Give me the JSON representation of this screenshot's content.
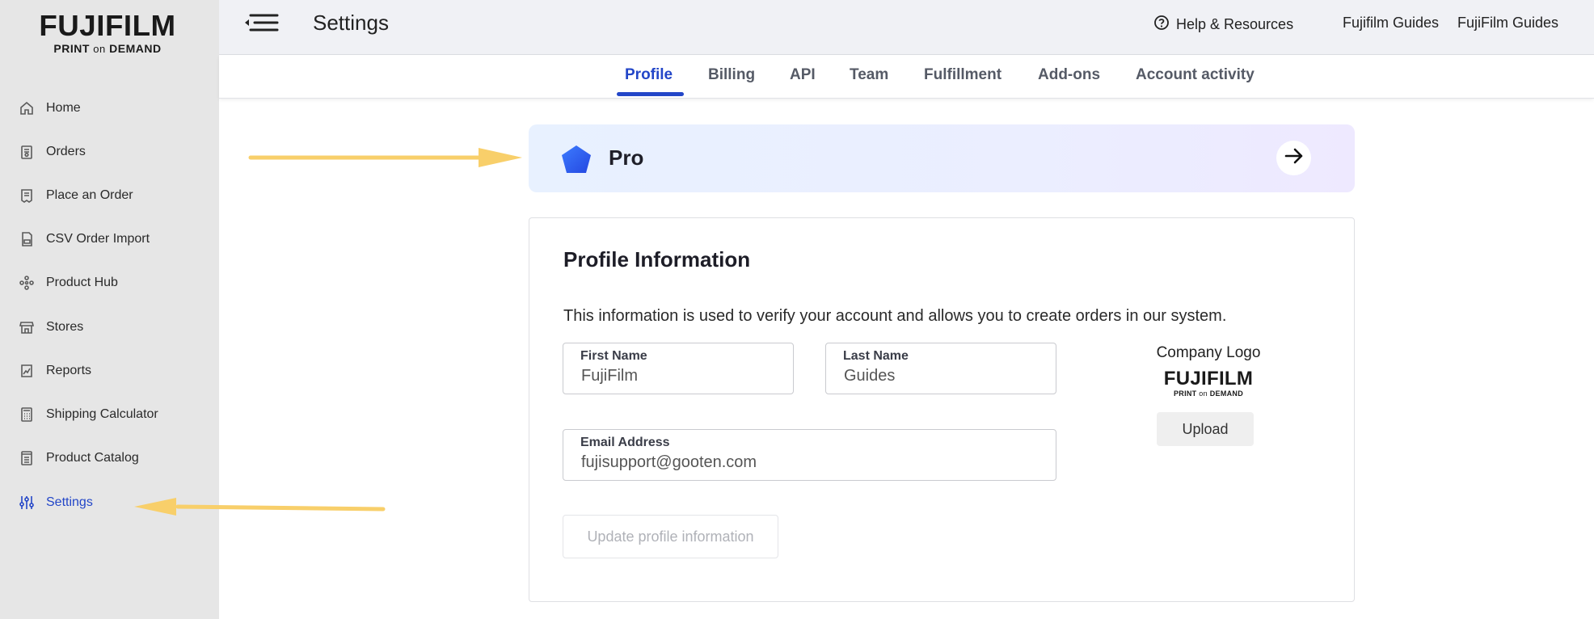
{
  "brand": {
    "logo_main": "FUJIFILM",
    "logo_sub_1": "PRINT",
    "logo_sub_on": "on",
    "logo_sub_2": "DEMAND",
    "accent_color": "#2346c8",
    "logo_red": "#c8102e"
  },
  "sidebar": {
    "items": [
      {
        "label": "Home",
        "icon": "home-icon"
      },
      {
        "label": "Orders",
        "icon": "orders-icon"
      },
      {
        "label": "Place an Order",
        "icon": "place-order-icon"
      },
      {
        "label": "CSV Order Import",
        "icon": "csv-icon"
      },
      {
        "label": "Product Hub",
        "icon": "product-hub-icon"
      },
      {
        "label": "Stores",
        "icon": "store-icon"
      },
      {
        "label": "Reports",
        "icon": "reports-icon"
      },
      {
        "label": "Shipping Calculator",
        "icon": "calculator-icon"
      },
      {
        "label": "Product Catalog",
        "icon": "catalog-icon"
      },
      {
        "label": "Settings",
        "icon": "settings-sliders-icon",
        "active": true
      }
    ]
  },
  "header": {
    "title": "Settings",
    "help_label": "Help & Resources",
    "user_company": "Fujifilm Guides",
    "user_name": "FujiFilm Guides"
  },
  "tabs": [
    {
      "label": "Profile",
      "active": true
    },
    {
      "label": "Billing"
    },
    {
      "label": "API"
    },
    {
      "label": "Team"
    },
    {
      "label": "Fulfillment"
    },
    {
      "label": "Add-ons"
    },
    {
      "label": "Account activity"
    }
  ],
  "plan": {
    "label": "Pro"
  },
  "profile": {
    "title": "Profile Information",
    "description": "This information is used to verify your account and allows you to create orders in our system.",
    "first_name_label": "First Name",
    "first_name": "FujiFilm",
    "last_name_label": "Last Name",
    "last_name": "Guides",
    "email_label": "Email Address",
    "email": "fujisupport@gooten.com",
    "company_logo_label": "Company Logo",
    "upload_label": "Upload",
    "update_label": "Update profile information"
  }
}
